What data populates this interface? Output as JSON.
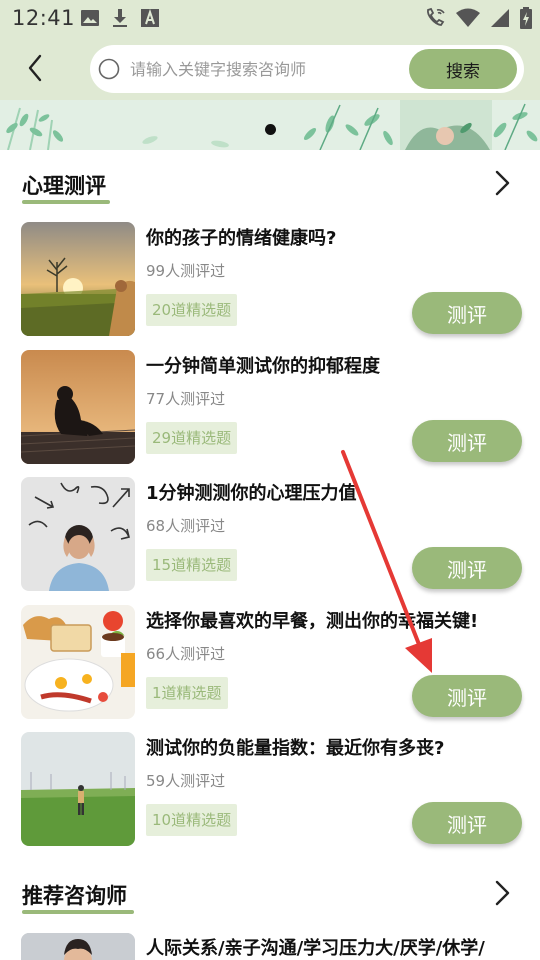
{
  "status_bar": {
    "time": "12:41",
    "left_icons": [
      "image-icon",
      "download-icon",
      "font-icon"
    ],
    "right_icons": [
      "phone-wifi-icon",
      "wifi-icon",
      "signal-icon",
      "battery-icon"
    ]
  },
  "header": {
    "back_icon": "chevron-left-icon",
    "search_placeholder": "请输入关键字搜索咨询师",
    "search_button": "搜索"
  },
  "tests_section": {
    "title": "心理测评",
    "more_icon": "chevron-right-icon",
    "items": [
      {
        "title": "你的孩子的情绪健康吗?",
        "count": "99人测评过",
        "tag": "20道精选题",
        "button": "测评"
      },
      {
        "title": "一分钟简单测试你的抑郁程度",
        "count": "77人测评过",
        "tag": "29道精选题",
        "button": "测评"
      },
      {
        "title": "1分钟测测你的心理压力值",
        "count": "68人测评过",
        "tag": "15道精选题",
        "button": "测评"
      },
      {
        "title": "选择你最喜欢的早餐，测出你的幸福关键!",
        "count": "66人测评过",
        "tag": "1道精选题",
        "button": "测评"
      },
      {
        "title": "测试你的负能量指数：最近你有多丧?",
        "count": "59人测评过",
        "tag": "10道精选题",
        "button": "测评"
      }
    ]
  },
  "counselors_section": {
    "title": "推荐咨询师",
    "more_icon": "chevron-right-icon",
    "first_item_tags": "人际关系/亲子沟通/学习压力大/厌学/休学/"
  },
  "colors": {
    "accent": "#9ab97a",
    "tag_bg": "#e6efdb",
    "header_bg": "#dfe9d3",
    "annotation_arrow": "#e53935"
  }
}
